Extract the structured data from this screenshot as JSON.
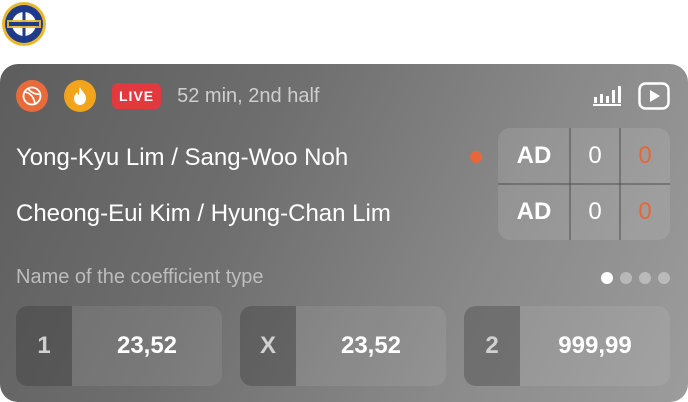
{
  "logo": {
    "name": "federation-crest-logo",
    "colors": {
      "ring": "#1e3a8a",
      "gold": "#e8b82e"
    }
  },
  "header": {
    "sport_icon": "volleyball-icon",
    "fire_icon": "fire-icon",
    "live_label": "LIVE",
    "time_status": "52 min, 2nd half",
    "stats_icon": "stats-bars-icon",
    "video_icon": "video-play-icon"
  },
  "match": {
    "team1": "Yong-Kyu Lim / Sang-Woo Noh",
    "team2": "Cheong-Eui Kim / Hyung-Chan Lim",
    "serving": "team1",
    "score": [
      {
        "ad": "AD",
        "games": "0",
        "points": "0"
      },
      {
        "ad": "AD",
        "games": "0",
        "points": "0"
      }
    ]
  },
  "coefficients": {
    "title": "Name of the coefficient type",
    "pages": 4,
    "active_page": 1,
    "odds": [
      {
        "label": "1",
        "value": "23,52"
      },
      {
        "label": "X",
        "value": "23,52"
      },
      {
        "label": "2",
        "value": "999,99"
      }
    ]
  },
  "colors": {
    "accent": "#e8673a",
    "live": "#e2393f",
    "fire": "#f2a51c"
  }
}
